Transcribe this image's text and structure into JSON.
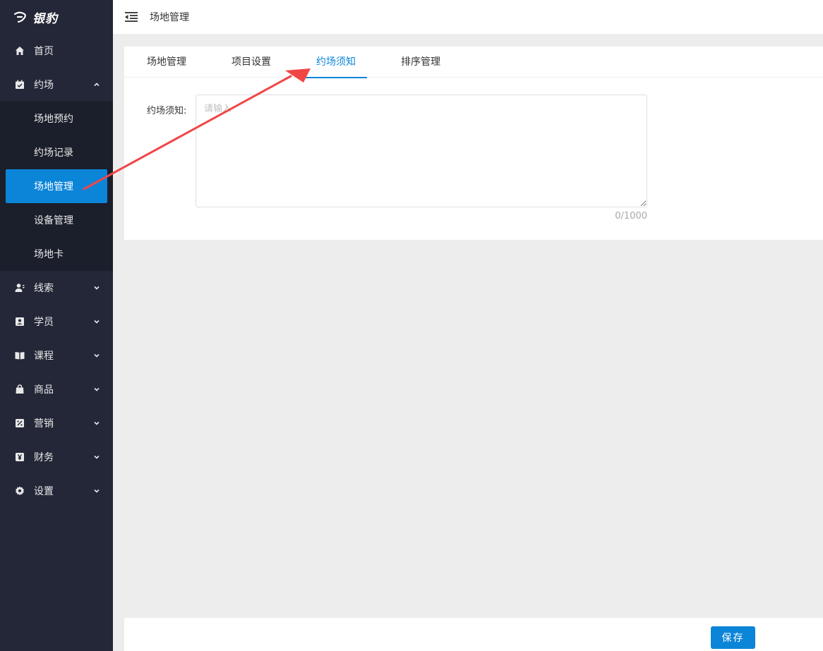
{
  "app": {
    "logo_text": "银豹"
  },
  "sidebar": {
    "items": [
      {
        "label": "首页",
        "icon": "home-icon"
      },
      {
        "label": "约场",
        "icon": "calendar-check-icon",
        "expanded": true,
        "children": [
          {
            "label": "场地预约"
          },
          {
            "label": "约场记录"
          },
          {
            "label": "场地管理",
            "active": true
          },
          {
            "label": "设备管理"
          },
          {
            "label": "场地卡"
          }
        ]
      },
      {
        "label": "线索",
        "icon": "user-lead-icon"
      },
      {
        "label": "学员",
        "icon": "student-card-icon"
      },
      {
        "label": "课程",
        "icon": "book-icon"
      },
      {
        "label": "商品",
        "icon": "bag-icon"
      },
      {
        "label": "营销",
        "icon": "percent-icon"
      },
      {
        "label": "财务",
        "icon": "yen-icon"
      },
      {
        "label": "设置",
        "icon": "gear-icon"
      }
    ]
  },
  "header": {
    "breadcrumb": "场地管理"
  },
  "tabs": [
    {
      "label": "场地管理"
    },
    {
      "label": "项目设置"
    },
    {
      "label": "约场须知",
      "active": true
    },
    {
      "label": "排序管理"
    }
  ],
  "form": {
    "label": "约场须知:",
    "placeholder": "请输入",
    "value": "",
    "counter": "0/1000"
  },
  "footer": {
    "save_label": "保存"
  },
  "colors": {
    "sidebar_bg": "#232737",
    "accent": "#0b85d8",
    "annotation_arrow": "#f04646"
  }
}
